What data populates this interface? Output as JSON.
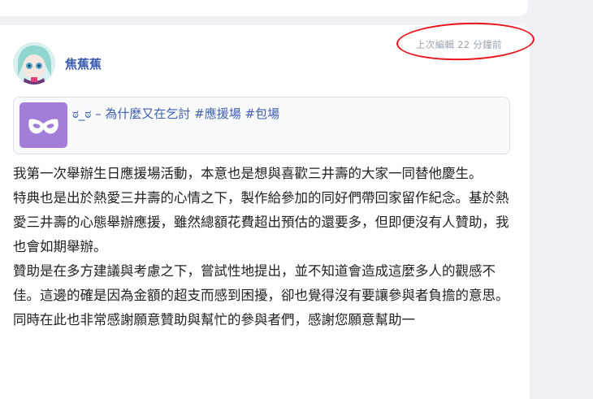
{
  "post": {
    "edited_label": "上次編輯 22 分鐘前",
    "author": "焦蕉蕉",
    "topic_title": "ಠ_ಠ – 為什麼又在乞討 #應援場 #包場",
    "topic_icon": "mask-icon",
    "paragraphs": [
      "我第一次舉辦生日應援場活動，本意也是想與喜歡三井壽的大家一同替他慶生。",
      "特典也是出於熱愛三井壽的心情之下，製作給參加的同好們帶回家留作紀念。基於熱愛三井壽的心態舉辦應援，雖然總額花費超出預估的還要多，但即便沒有人贊助，我也會如期舉辦。",
      "贊助是在多方建議與考慮之下，嘗試性地提出，並不知道會造成這麼多人的觀感不佳。這邊的確是因為金額的超支而感到困擾，卻也覺得沒有要讓參與者負擔的意思。",
      "同時在此也非常感謝願意贊助與幫忙的參與者們，感謝您願意幫助一"
    ]
  },
  "colors": {
    "annotation": "#e8141b",
    "link": "#3f5fb3",
    "topic_icon_bg": "#a27ed8"
  }
}
